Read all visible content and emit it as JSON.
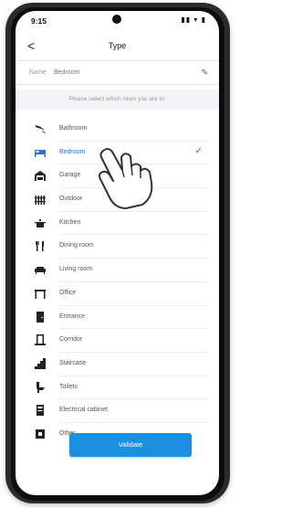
{
  "status_bar": {
    "time": "9:15",
    "icons": "▮▮ ▾ ▮"
  },
  "header": {
    "back_label": "<",
    "title": "Type"
  },
  "name_field": {
    "label": "Name",
    "value": "Bedroom"
  },
  "prompt": "Please select which room you are in:",
  "rooms": [
    {
      "label": "Bathroom",
      "icon": "shower-icon",
      "selected": false
    },
    {
      "label": "Bedroom",
      "icon": "bed-icon",
      "selected": true
    },
    {
      "label": "Garage",
      "icon": "garage-icon",
      "selected": false
    },
    {
      "label": "Outdoor",
      "icon": "fence-icon",
      "selected": false
    },
    {
      "label": "Kitchen",
      "icon": "pot-icon",
      "selected": false
    },
    {
      "label": "Dining room",
      "icon": "fork-knife-icon",
      "selected": false
    },
    {
      "label": "Living room",
      "icon": "sofa-icon",
      "selected": false
    },
    {
      "label": "Office",
      "icon": "desk-icon",
      "selected": false
    },
    {
      "label": "Entrance",
      "icon": "door-icon",
      "selected": false
    },
    {
      "label": "Corridor",
      "icon": "corridor-icon",
      "selected": false
    },
    {
      "label": "Staircase",
      "icon": "stairs-icon",
      "selected": false
    },
    {
      "label": "Toilets",
      "icon": "toilet-icon",
      "selected": false
    },
    {
      "label": "Electrical cabinet",
      "icon": "cabinet-icon",
      "selected": false
    },
    {
      "label": "Other",
      "icon": "other-icon",
      "selected": false
    }
  ],
  "validate_label": "Validate",
  "colors": {
    "accent": "#2f6fd6",
    "button": "#1d8fe0"
  }
}
